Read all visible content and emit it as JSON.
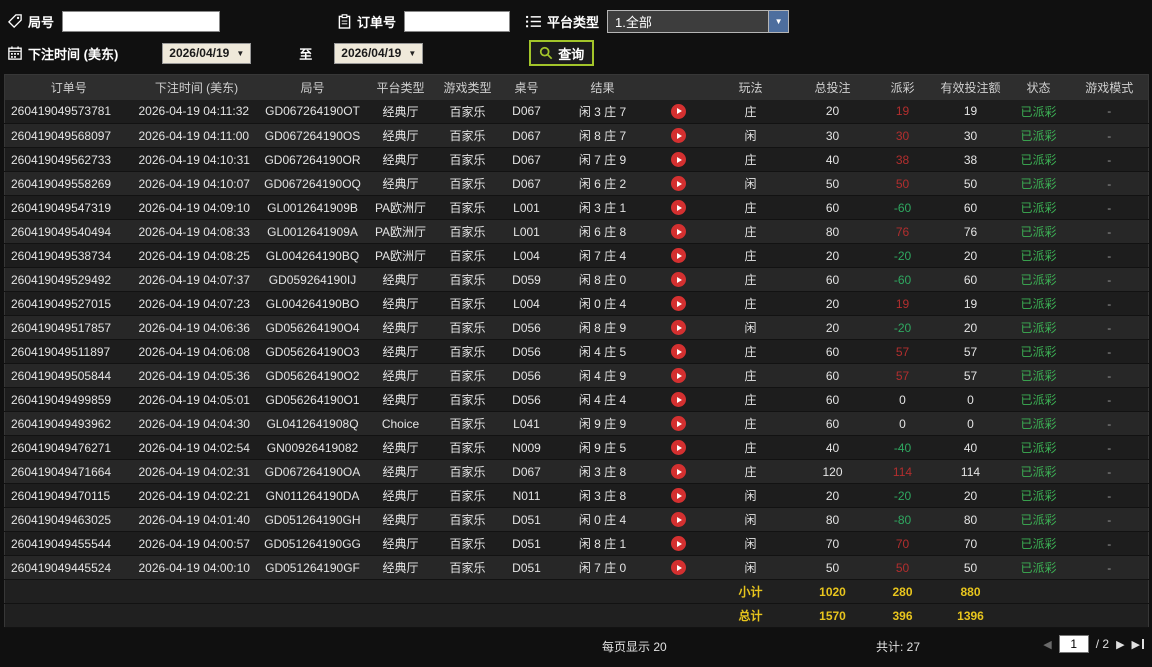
{
  "filters": {
    "round_label": "局号",
    "order_label": "订单号",
    "platform_label": "平台类型",
    "platform_value": "1.全部",
    "bet_time_label": "下注时间 (美东)",
    "date_from": "2026/04/19",
    "date_to": "2026/04/19",
    "to_label": "至",
    "search_label": "查询"
  },
  "table": {
    "headers": [
      "订单号",
      "下注时间 (美东)",
      "局号",
      "平台类型",
      "游戏类型",
      "桌号",
      "结果",
      "",
      "玩法",
      "总投注",
      "派彩",
      "有效投注额",
      "状态",
      "游戏模式"
    ],
    "rows": [
      [
        "260419049573781",
        "2026-04-19 04:11:32",
        "GD067264190OT",
        "经典厅",
        "百家乐",
        "D067",
        "闲 3 庄 7",
        "庄",
        20,
        19,
        19,
        "已派彩",
        "-"
      ],
      [
        "260419049568097",
        "2026-04-19 04:11:00",
        "GD067264190OS",
        "经典厅",
        "百家乐",
        "D067",
        "闲 8 庄 7",
        "闲",
        30,
        30,
        30,
        "已派彩",
        "-"
      ],
      [
        "260419049562733",
        "2026-04-19 04:10:31",
        "GD067264190OR",
        "经典厅",
        "百家乐",
        "D067",
        "闲 7 庄 9",
        "庄",
        40,
        38,
        38,
        "已派彩",
        "-"
      ],
      [
        "260419049558269",
        "2026-04-19 04:10:07",
        "GD067264190OQ",
        "经典厅",
        "百家乐",
        "D067",
        "闲 6 庄 2",
        "闲",
        50,
        50,
        50,
        "已派彩",
        "-"
      ],
      [
        "260419049547319",
        "2026-04-19 04:09:10",
        "GL0012641909B",
        "PA欧洲厅",
        "百家乐",
        "L001",
        "闲 3 庄 1",
        "庄",
        60,
        -60,
        60,
        "已派彩",
        "-"
      ],
      [
        "260419049540494",
        "2026-04-19 04:08:33",
        "GL0012641909A",
        "PA欧洲厅",
        "百家乐",
        "L001",
        "闲 6 庄 8",
        "庄",
        80,
        76,
        76,
        "已派彩",
        "-"
      ],
      [
        "260419049538734",
        "2026-04-19 04:08:25",
        "GL004264190BQ",
        "PA欧洲厅",
        "百家乐",
        "L004",
        "闲 7 庄 4",
        "庄",
        20,
        -20,
        20,
        "已派彩",
        "-"
      ],
      [
        "260419049529492",
        "2026-04-19 04:07:37",
        "GD059264190IJ",
        "经典厅",
        "百家乐",
        "D059",
        "闲 8 庄 0",
        "庄",
        60,
        -60,
        60,
        "已派彩",
        "-"
      ],
      [
        "260419049527015",
        "2026-04-19 04:07:23",
        "GL004264190BO",
        "经典厅",
        "百家乐",
        "L004",
        "闲 0 庄 4",
        "庄",
        20,
        19,
        19,
        "已派彩",
        "-"
      ],
      [
        "260419049517857",
        "2026-04-19 04:06:36",
        "GD056264190O4",
        "经典厅",
        "百家乐",
        "D056",
        "闲 8 庄 9",
        "闲",
        20,
        -20,
        20,
        "已派彩",
        "-"
      ],
      [
        "260419049511897",
        "2026-04-19 04:06:08",
        "GD056264190O3",
        "经典厅",
        "百家乐",
        "D056",
        "闲 4 庄 5",
        "庄",
        60,
        57,
        57,
        "已派彩",
        "-"
      ],
      [
        "260419049505844",
        "2026-04-19 04:05:36",
        "GD056264190O2",
        "经典厅",
        "百家乐",
        "D056",
        "闲 4 庄 9",
        "庄",
        60,
        57,
        57,
        "已派彩",
        "-"
      ],
      [
        "260419049499859",
        "2026-04-19 04:05:01",
        "GD056264190O1",
        "经典厅",
        "百家乐",
        "D056",
        "闲 4 庄 4",
        "庄",
        60,
        0,
        0,
        "已派彩",
        "-"
      ],
      [
        "260419049493962",
        "2026-04-19 04:04:30",
        "GL0412641908Q",
        "Choice",
        "百家乐",
        "L041",
        "闲 9 庄 9",
        "庄",
        60,
        0,
        0,
        "已派彩",
        "-"
      ],
      [
        "260419049476271",
        "2026-04-19 04:02:54",
        "GN00926419082",
        "经典厅",
        "百家乐",
        "N009",
        "闲 9 庄 5",
        "庄",
        40,
        -40,
        40,
        "已派彩",
        "-"
      ],
      [
        "260419049471664",
        "2026-04-19 04:02:31",
        "GD067264190OA",
        "经典厅",
        "百家乐",
        "D067",
        "闲 3 庄 8",
        "庄",
        120,
        114,
        114,
        "已派彩",
        "-"
      ],
      [
        "260419049470115",
        "2026-04-19 04:02:21",
        "GN011264190DA",
        "经典厅",
        "百家乐",
        "N011",
        "闲 3 庄 8",
        "闲",
        20,
        -20,
        20,
        "已派彩",
        "-"
      ],
      [
        "260419049463025",
        "2026-04-19 04:01:40",
        "GD051264190GH",
        "经典厅",
        "百家乐",
        "D051",
        "闲 0 庄 4",
        "闲",
        80,
        -80,
        80,
        "已派彩",
        "-"
      ],
      [
        "260419049455544",
        "2026-04-19 04:00:57",
        "GD051264190GG",
        "经典厅",
        "百家乐",
        "D051",
        "闲 8 庄 1",
        "闲",
        70,
        70,
        70,
        "已派彩",
        "-"
      ],
      [
        "260419049445524",
        "2026-04-19 04:00:10",
        "GD051264190GF",
        "经典厅",
        "百家乐",
        "D051",
        "闲 7 庄 0",
        "闲",
        50,
        50,
        50,
        "已派彩",
        "-"
      ]
    ],
    "subtotal": {
      "label": "小计",
      "total": 1020,
      "payout": 280,
      "valid": 880
    },
    "grand_total": {
      "label": "总计",
      "total": 1570,
      "payout": 396,
      "valid": 1396
    }
  },
  "footer": {
    "per_page_label": "每页显示 20",
    "total_label": "共计: 27",
    "page_value": "1",
    "page_total": "/ 2"
  },
  "colors": {
    "payout_positive": "#b22e2e",
    "payout_negative": "#2fa860",
    "status_paid": "#3cb054",
    "totals_yellow": "#e8c51d",
    "search_accent": "#a3c52a",
    "play_button_red": "#d43030"
  }
}
